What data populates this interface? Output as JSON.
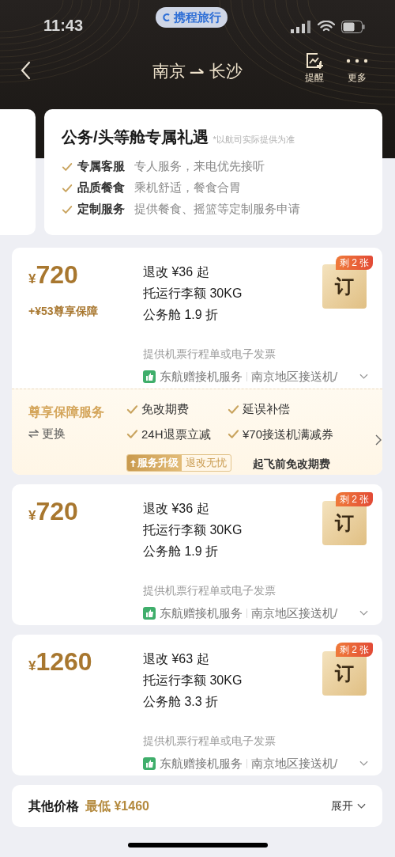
{
  "status_bar": {
    "time": "11:43",
    "app_badge": "携程旅行"
  },
  "nav": {
    "origin": "南京",
    "destination": "长沙",
    "actions": [
      {
        "kind": "alert",
        "label": "提醒"
      },
      {
        "kind": "more",
        "label": "更多"
      }
    ]
  },
  "privileges": {
    "title": "公务/头等舱专属礼遇",
    "note": "*以航司实际提供为准",
    "items": [
      {
        "name": "专属客服",
        "desc": "专人服务，来电优先接听"
      },
      {
        "name": "品质餐食",
        "desc": "乘机舒适，餐食合胃"
      },
      {
        "name": "定制服务",
        "desc": "提供餐食、摇篮等定制服务申请"
      }
    ]
  },
  "fares": [
    {
      "currency": "¥",
      "price": "720",
      "protection": "+¥53尊享保障",
      "details": [
        "退改 ¥36 起",
        "托运行李额 30KG",
        "公务舱 1.9 折"
      ],
      "note": "提供机票行程单或电子发票",
      "service": "东航赠接机服务",
      "service_detail": "南京地区接送机/",
      "book": "订",
      "remaining": "剩 2 张",
      "protection_service": {
        "title": "尊享保障服务",
        "switch": "更换",
        "items": [
          "免改期费",
          "延误补偿",
          "24H退票立减",
          "¥70接送机满减券"
        ],
        "upgrade": "服务升级",
        "upgrade_tag": "退改无忧",
        "tagline": "起飞前免改期费"
      }
    },
    {
      "currency": "¥",
      "price": "720",
      "details": [
        "退改 ¥36 起",
        "托运行李额 30KG",
        "公务舱 1.9 折"
      ],
      "note": "提供机票行程单或电子发票",
      "service": "东航赠接机服务",
      "service_detail": "南京地区接送机/",
      "book": "订",
      "remaining": "剩 2 张"
    },
    {
      "currency": "¥",
      "price": "1260",
      "details": [
        "退改 ¥63 起",
        "托运行李额 30KG",
        "公务舱 3.3 折"
      ],
      "note": "提供机票行程单或电子发票",
      "service": "东航赠接机服务",
      "service_detail": "南京地区接送机/",
      "book": "订",
      "remaining": "剩 2 张"
    }
  ],
  "other_prices": {
    "label": "其他价格",
    "lowest": "最低 ¥1460",
    "expand": "展开"
  }
}
